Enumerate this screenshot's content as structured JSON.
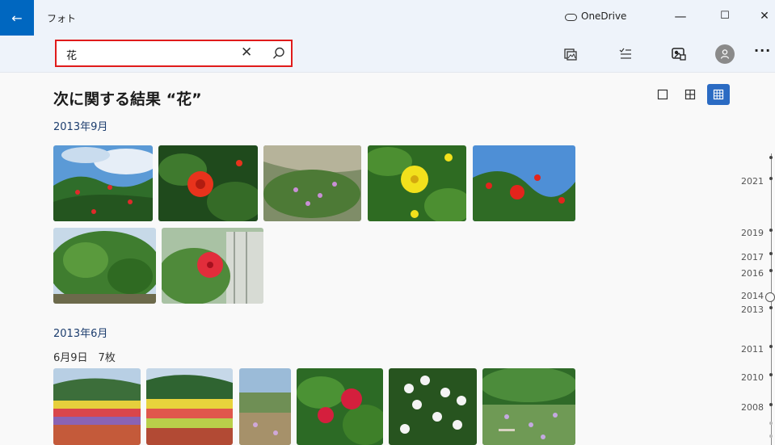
{
  "app": {
    "back_glyph": "←",
    "title": "フォト",
    "onedrive_label": "OneDrive"
  },
  "window_controls": {
    "minimize": "—",
    "maximize": "☐",
    "close": "✕"
  },
  "search": {
    "value": "花",
    "clear_glyph": "✕"
  },
  "toolbar_icons": [
    "import-icon",
    "select-icon",
    "slideshow-icon",
    "account-icon",
    "more-icon"
  ],
  "more_glyph": "···",
  "results": {
    "heading": "次に関する結果 “花”",
    "groups": [
      {
        "date": "2013年9月"
      },
      {
        "date": "2013年6月",
        "subheading": "6月9日　7枚"
      }
    ]
  },
  "view_modes": {
    "selected": "small-grid",
    "options": [
      "single",
      "medium-grid",
      "small-grid"
    ]
  },
  "timeline": {
    "years": [
      "2021",
      "2019",
      "2017",
      "2016",
      "2014",
      "2013",
      "2011",
      "2010",
      "2008"
    ],
    "current": "2014"
  },
  "colors": {
    "accent": "#0067c0",
    "search_highlight": "#e01b1b",
    "selected_view": "#2b6bc3"
  }
}
